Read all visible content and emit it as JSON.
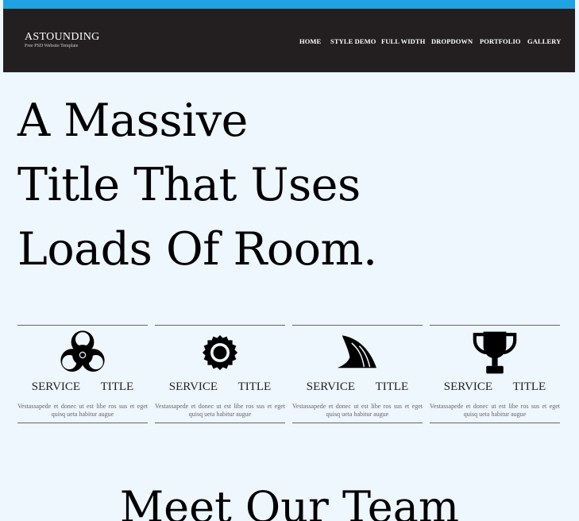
{
  "header": {
    "logo_name": "ASTOUNDING",
    "logo_tagline": "Free PSD Website Template",
    "accent_color": "#1fa2e1",
    "background_color": "#231f20"
  },
  "nav": {
    "items": [
      {
        "label": "HOME"
      },
      {
        "label": "STYLE DEMO"
      },
      {
        "label": "FULL WIDTH"
      },
      {
        "label": "DROPDOWN"
      },
      {
        "label": "PORTFOLIO"
      },
      {
        "label": "GALLERY"
      }
    ]
  },
  "hero": {
    "lines": [
      "A Massive",
      "Title That Uses",
      "Loads Of Room."
    ]
  },
  "services": [
    {
      "icon": "biohazard-icon",
      "title": "SERVICE TITLE",
      "description": "Vestassapede et donec ut est libe ros sus et eget quisq ueta habitur augue"
    },
    {
      "icon": "sun-icon",
      "title": "SERVICE TITLE",
      "description": "Vestassapede et donec ut est libe ros sus et eget quisq ueta habitur augue"
    },
    {
      "icon": "shark-fin-icon",
      "title": "SERVICE TITLE",
      "description": "Vestassapede et donec ut est libe ros sus et eget quisq ueta habitur augue"
    },
    {
      "icon": "trophy-icon",
      "title": "SERVICE TITLE",
      "description": "Vestassapede et donec ut est libe ros sus et eget quisq ueta habitur augue"
    }
  ],
  "team": {
    "title": "Meet Our Team"
  }
}
